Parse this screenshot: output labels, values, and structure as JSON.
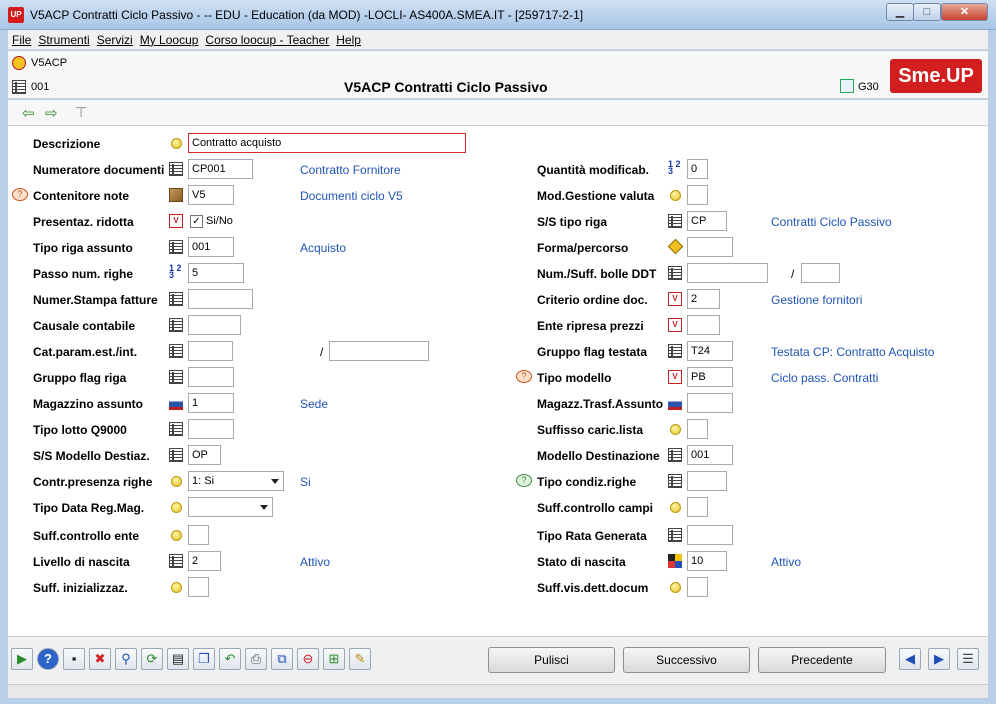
{
  "window": {
    "title": "V5ACP Contratti Ciclo Passivo -  -- EDU - Education (da MOD) -LOCLI- AS400A.SMEA.IT - [259717-2-1]",
    "app_icon": "UP",
    "minimize": "▁",
    "maximize": "□",
    "close": "✕"
  },
  "menu": [
    "File",
    "Strumenti",
    "Servizi",
    "My Loocup",
    "Corso loocup - Teacher",
    "Help"
  ],
  "header": {
    "code": "V5ACP",
    "sub_code": "001",
    "title": "V5ACP Contratti Ciclo Passivo",
    "right_code": "G30",
    "logo": "Sme.UP"
  },
  "left_fields": [
    {
      "label": "Descrizione",
      "value": "Contratto acquisto",
      "desc": ""
    },
    {
      "label": "Numeratore documenti",
      "value": "CP001",
      "desc": "Contratto Fornitore"
    },
    {
      "label": "Contenitore note",
      "value": "V5",
      "desc": "Documenti ciclo V5"
    },
    {
      "label": "Presentaz. ridotta",
      "value": "Si/No",
      "desc": ""
    },
    {
      "label": "Tipo riga assunto",
      "value": "001",
      "desc": "Acquisto"
    },
    {
      "label": "Passo num. righe",
      "value": "5",
      "desc": ""
    },
    {
      "label": "Numer.Stampa fatture",
      "value": "",
      "desc": ""
    },
    {
      "label": "Causale contabile",
      "value": "",
      "desc": ""
    },
    {
      "label": "Cat.param.est./int.",
      "value": "",
      "value2": "",
      "desc": ""
    },
    {
      "label": "Gruppo flag riga",
      "value": "",
      "desc": ""
    },
    {
      "label": "Magazzino assunto",
      "value": "1",
      "desc": "Sede"
    },
    {
      "label": "Tipo lotto Q9000",
      "value": "",
      "desc": ""
    },
    {
      "label": "S/S Modello Destiaz.",
      "value": "OP",
      "desc": ""
    },
    {
      "label": "Contr.presenza righe",
      "value": "1: Si",
      "desc": "Si"
    },
    {
      "label": "Tipo Data Reg.Mag.",
      "value": "",
      "desc": ""
    },
    {
      "label": "Suff.controllo ente",
      "value": "",
      "desc": ""
    },
    {
      "label": "Livello di nascita",
      "value": "2",
      "desc": "Attivo"
    },
    {
      "label": "Suff. inizializzaz.",
      "value": "",
      "desc": ""
    }
  ],
  "slash": "/",
  "right_fields": [
    {
      "label": "Quantità modificab.",
      "value": "0",
      "desc": ""
    },
    {
      "label": "Mod.Gestione valuta",
      "value": "",
      "desc": ""
    },
    {
      "label": "S/S tipo riga",
      "value": "CP",
      "desc": "Contratti Ciclo Passivo"
    },
    {
      "label": "Forma/percorso",
      "value": "",
      "desc": ""
    },
    {
      "label": "Num./Suff. bolle DDT",
      "value": "",
      "value2": "",
      "desc": ""
    },
    {
      "label": "Criterio ordine doc.",
      "value": "2",
      "desc": "Gestione fornitori"
    },
    {
      "label": "Ente ripresa prezzi",
      "value": "",
      "desc": ""
    },
    {
      "label": "Gruppo flag testata",
      "value": "T24",
      "desc": "Testata CP: Contratto Acquisto"
    },
    {
      "label": "Tipo modello",
      "value": "PB",
      "desc": "Ciclo pass. Contratti"
    },
    {
      "label": "Magazz.Trasf.Assunto",
      "value": "",
      "desc": ""
    },
    {
      "label": "Suffisso caric.lista",
      "value": "",
      "desc": ""
    },
    {
      "label": "Modello Destinazione",
      "value": "001",
      "desc": ""
    },
    {
      "label": "Tipo condiz.righe",
      "value": "",
      "desc": ""
    },
    {
      "label": "Suff.controllo campi",
      "value": "",
      "desc": ""
    },
    {
      "label": "Tipo Rata Generata",
      "value": "",
      "desc": ""
    },
    {
      "label": "Stato di nascita",
      "value": "10",
      "desc": "Attivo"
    },
    {
      "label": "Suff.vis.dett.docum",
      "value": "",
      "desc": ""
    }
  ],
  "buttons": {
    "pulisci": "Pulisci",
    "successivo": "Successivo",
    "precedente": "Precedente"
  },
  "toolbar_icons": [
    "play-icon",
    "help-icon",
    "terminal-icon",
    "cancel-icon",
    "search-icon",
    "refresh-icon",
    "save-icon",
    "copy-icon",
    "undo-icon",
    "print-icon",
    "duplicate-icon",
    "stop-icon",
    "export-icon",
    "wand-icon"
  ],
  "glyphs": {
    "play": "▶",
    "help": "?",
    "terminal": "▪",
    "cancel": "✖",
    "search": "⚲",
    "refresh": "⟳",
    "save": "▤",
    "copy": "❐",
    "undo": "↶",
    "print": "⎙",
    "duplicate": "⧉",
    "stop": "⊖",
    "export": "⊞",
    "wand": "✎",
    "prev": "◀",
    "next": "▶",
    "list": "☰",
    "tb_back": "⇦",
    "tb_fwd": "⇨",
    "tb_tree": "⊤",
    "check": "✓",
    "bubble": "?"
  }
}
